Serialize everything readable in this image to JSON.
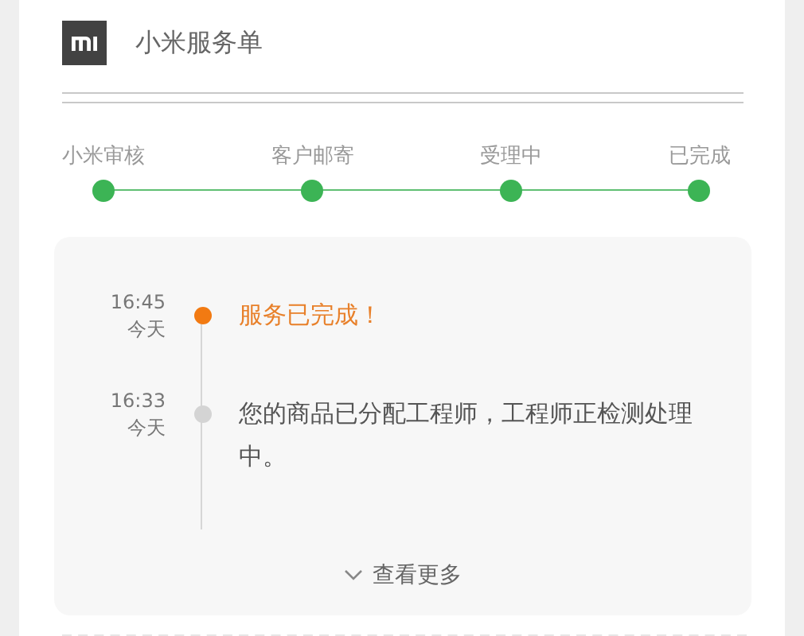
{
  "header": {
    "title": "小米服务单"
  },
  "steps": [
    {
      "label": "小米审核",
      "done": true
    },
    {
      "label": "客户邮寄",
      "done": true
    },
    {
      "label": "受理中",
      "done": true
    },
    {
      "label": "已完成",
      "done": true
    }
  ],
  "timeline": [
    {
      "time": "16:45",
      "day": "今天",
      "text": "服务已完成！",
      "current": true
    },
    {
      "time": "16:33",
      "day": "今天",
      "text": "您的商品已分配工程师，工程师正检测处理中。",
      "current": false
    }
  ],
  "more_link": "查看更多"
}
